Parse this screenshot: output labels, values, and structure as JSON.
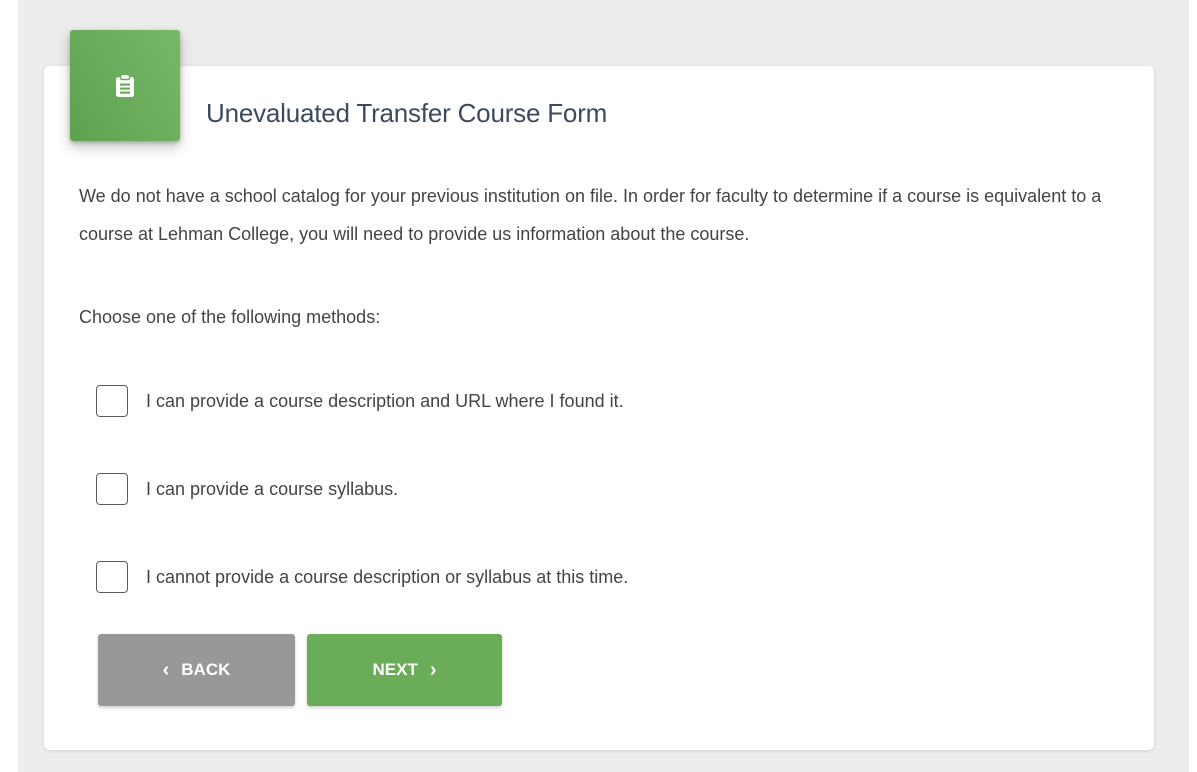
{
  "form": {
    "title": "Unevaluated Transfer Course Form",
    "intro": "We do not have a school catalog for your previous institution on file. In order for faculty to determine if a course is equivalent to a course at Lehman College, you will need to provide us information about the course.",
    "prompt": "Choose one of the following methods:",
    "options": [
      {
        "label": "I can provide a course description and URL where I found it.",
        "checked": false
      },
      {
        "label": "I can provide a course syllabus.",
        "checked": false
      },
      {
        "label": "I cannot provide a course description or syllabus at this time.",
        "checked": false
      }
    ]
  },
  "buttons": {
    "back_label": "BACK",
    "back_icon": "chevron-left-icon",
    "next_label": "NEXT",
    "next_icon": "chevron-right-icon"
  },
  "header_icon": "clipboard-icon",
  "colors": {
    "accent_green": "#6aac57",
    "back_gray": "#989898",
    "title_text": "#3d4a5c",
    "body_text": "#444444",
    "page_background": "#ededed"
  }
}
